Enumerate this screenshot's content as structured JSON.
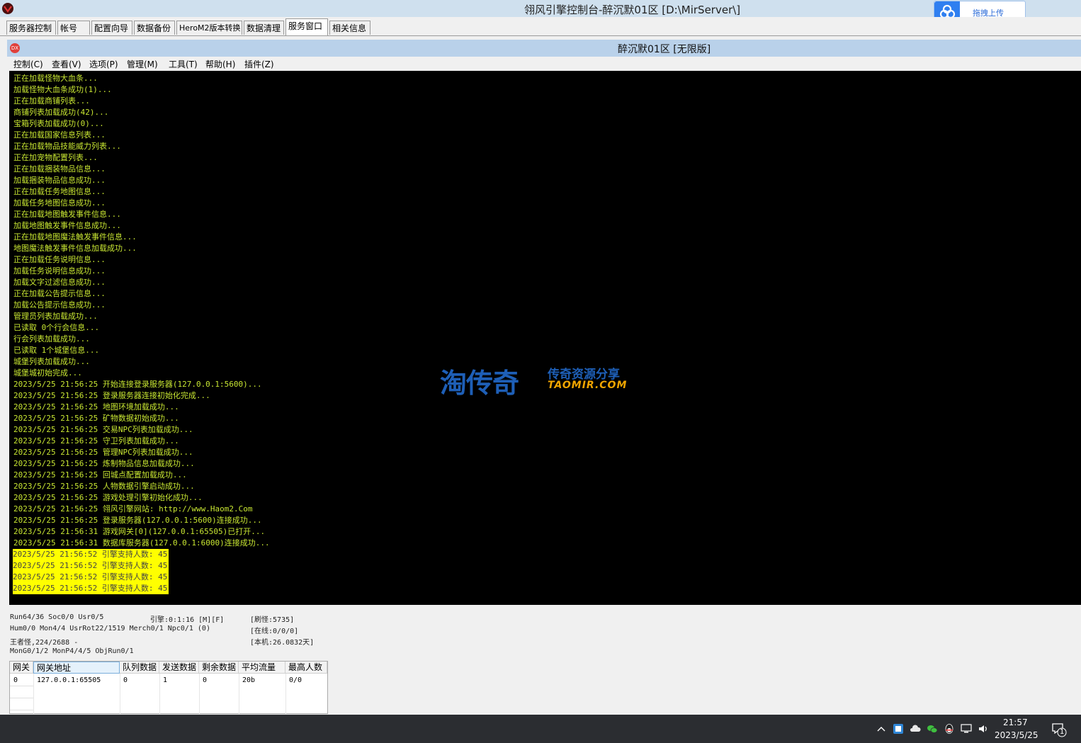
{
  "outer_window": {
    "title": "翎风引擎控制台-醉沉默01区 [D:\\MirServer\\]",
    "cloud_button_label": "拖拽上传"
  },
  "tabs": [
    "服务器控制",
    "帐号",
    "配置向导",
    "数据备份",
    "HeroM2版本转换",
    "数据清理",
    "服务窗口",
    "相关信息"
  ],
  "active_tab": "服务窗口",
  "inner_window": {
    "icon_text": "DX",
    "title": "醉沉默01区 [无限版]",
    "menu": [
      "控制(C)",
      "查看(V)",
      "选项(P)",
      "管理(M)",
      "工具(T)",
      "帮助(H)",
      "插件(Z)"
    ]
  },
  "console": {
    "text_color": "#c8e632",
    "highlight_color": "#ffff00",
    "lines": [
      {
        "text": "正在加载怪物大血条...",
        "hl": false
      },
      {
        "text": "加载怪物大血条成功(1)...",
        "hl": false
      },
      {
        "text": "正在加载商铺列表...",
        "hl": false
      },
      {
        "text": "商铺列表加载成功(42)...",
        "hl": false
      },
      {
        "text": "宝箱列表加载成功(0)...",
        "hl": false
      },
      {
        "text": "正在加载国家信息列表...",
        "hl": false
      },
      {
        "text": "正在加载物品技能威力列表...",
        "hl": false
      },
      {
        "text": "正在加宠物配置列表...",
        "hl": false
      },
      {
        "text": "正在加载捆装物品信息...",
        "hl": false
      },
      {
        "text": "加载捆装物品信息成功...",
        "hl": false
      },
      {
        "text": "正在加载任务地图信息...",
        "hl": false
      },
      {
        "text": "加载任务地图信息成功...",
        "hl": false
      },
      {
        "text": "正在加载地图触发事件信息...",
        "hl": false
      },
      {
        "text": "加载地图触发事件信息成功...",
        "hl": false
      },
      {
        "text": "正在加载地图魔法触发事件信息...",
        "hl": false
      },
      {
        "text": "地图魔法触发事件信息加载成功...",
        "hl": false
      },
      {
        "text": "正在加载任务说明信息...",
        "hl": false
      },
      {
        "text": "加载任务说明信息成功...",
        "hl": false
      },
      {
        "text": "加载文字过滤信息成功...",
        "hl": false
      },
      {
        "text": "正在加载公告提示信息...",
        "hl": false
      },
      {
        "text": "加载公告提示信息成功...",
        "hl": false
      },
      {
        "text": "管理员列表加载成功...",
        "hl": false
      },
      {
        "text": "已读取 0个行会信息...",
        "hl": false
      },
      {
        "text": "行会列表加载成功...",
        "hl": false
      },
      {
        "text": "已读取 1个城堡信息...",
        "hl": false
      },
      {
        "text": "城堡列表加载成功...",
        "hl": false
      },
      {
        "text": "城堡城初始完成...",
        "hl": false
      },
      {
        "text": "2023/5/25 21:56:25 开始连接登录服务器(127.0.0.1:5600)...",
        "hl": false
      },
      {
        "text": "2023/5/25 21:56:25 登录服务器连接初始化完成...",
        "hl": false
      },
      {
        "text": "2023/5/25 21:56:25 地图环境加载成功...",
        "hl": false
      },
      {
        "text": "2023/5/25 21:56:25 矿物数据初始成功...",
        "hl": false
      },
      {
        "text": "2023/5/25 21:56:25 交易NPC列表加载成功...",
        "hl": false
      },
      {
        "text": "2023/5/25 21:56:25 守卫列表加载成功...",
        "hl": false
      },
      {
        "text": "2023/5/25 21:56:25 管理NPC列表加载成功...",
        "hl": false
      },
      {
        "text": "2023/5/25 21:56:25 炼制物品信息加载成功...",
        "hl": false
      },
      {
        "text": "2023/5/25 21:56:25 回城点配置加载成功...",
        "hl": false
      },
      {
        "text": "2023/5/25 21:56:25 人物数据引擎启动成功...",
        "hl": false
      },
      {
        "text": "2023/5/25 21:56:25 游戏处理引擎初始化成功...",
        "hl": false
      },
      {
        "text": "2023/5/25 21:56:25 翎风引擎网站: http://www.Haom2.Com",
        "hl": false
      },
      {
        "text": "2023/5/25 21:56:25 登录服务器(127.0.0.1:5600)连接成功...",
        "hl": false
      },
      {
        "text": "2023/5/25 21:56:31 游戏网关[0](127.0.0.1:65505)已打开...",
        "hl": false
      },
      {
        "text": "2023/5/25 21:56:31 数据库服务器(127.0.0.1:6000)连接成功...",
        "hl": false
      },
      {
        "text": "2023/5/25 21:56:52 引擎支持人数: 45",
        "hl": true
      },
      {
        "text": "2023/5/25 21:56:52 引擎支持人数: 45",
        "hl": true
      },
      {
        "text": "2023/5/25 21:56:52 引擎支持人数: 45",
        "hl": true
      },
      {
        "text": "2023/5/25 21:56:52 引擎支持人数: 45",
        "hl": true
      }
    ]
  },
  "watermark": {
    "big": "淘传奇",
    "small": "传奇资源分享",
    "url": "TAOMIR.COM"
  },
  "status": {
    "run": "Run64/36 Soc0/0 Usr0/5",
    "engine_time": "引擎:0:1:16 [M][F]",
    "refresh": "[刷怪:5735]",
    "hum": "Hum0/0 Mon4/4 UsrRot22/1519 Merch0/1 Npc0/1 (0)",
    "online": "[在线:0/0/0]",
    "monster": "王者怪,224/2688 -",
    "local": "[本机:26.0832天]",
    "mongo": "MonG0/1/2 MonP4/4/5 ObjRun0/1"
  },
  "gateway_table": {
    "headers": [
      "网关",
      "网关地址",
      "队列数据",
      "发送数据",
      "剩余数据",
      "平均流量",
      "最高人数"
    ],
    "rows": [
      [
        "0",
        "127.0.0.1:65505",
        "0",
        "1",
        "0",
        "20b",
        "0/0"
      ]
    ]
  },
  "taskbar": {
    "time": "21:57",
    "date": "2023/5/25",
    "notification_count": "1"
  }
}
